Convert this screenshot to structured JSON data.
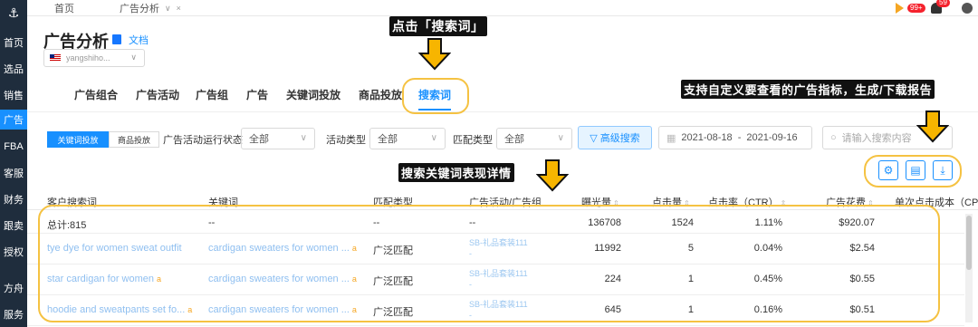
{
  "sidebar": {
    "items": [
      {
        "label": "首页"
      },
      {
        "label": "选品"
      },
      {
        "label": "销售"
      },
      {
        "label": "广告"
      },
      {
        "label": "FBA"
      },
      {
        "label": "客服"
      },
      {
        "label": "财务"
      },
      {
        "label": "跟卖"
      },
      {
        "label": "授权"
      },
      {
        "label": "方舟"
      },
      {
        "label": "服务"
      }
    ],
    "active_index": 3
  },
  "topbar": {
    "tabs": [
      {
        "label": "首页"
      },
      {
        "label": "广告分析"
      }
    ],
    "play_badge": "99+",
    "bell_badge": "59"
  },
  "header": {
    "title": "广告分析",
    "doc_link": "文档",
    "store": "yangshiho..."
  },
  "nav_tabs": [
    {
      "label": "广告组合"
    },
    {
      "label": "广告活动"
    },
    {
      "label": "广告组"
    },
    {
      "label": "广告"
    },
    {
      "label": "关键词投放"
    },
    {
      "label": "商品投放"
    },
    {
      "label": "搜索词"
    }
  ],
  "filters": {
    "seg_keyword": "关键词投放",
    "seg_product": "商品投放",
    "status_label": "广告活动运行状态",
    "status_value": "全部",
    "activity_label": "活动类型",
    "activity_value": "全部",
    "match_label": "匹配类型",
    "match_value": "全部",
    "advanced_search": "高级搜索",
    "date_start": "2021-08-18",
    "date_sep": "-",
    "date_end": "2021-09-16",
    "search_placeholder": "请输入搜索内容"
  },
  "table": {
    "headers": {
      "customer_search_term": "客户搜索词",
      "keyword": "关键词",
      "match_type": "匹配类型",
      "campaign_group": "广告活动/广告组",
      "impressions": "曝光量",
      "clicks": "点击量",
      "ctr": "点击率（CTR）",
      "spend": "广告花费",
      "cpc": "单次点击成本（CP"
    },
    "total": {
      "label": "总计:815",
      "keyword": "--",
      "match_type": "--",
      "campaign": "--",
      "impressions": "136708",
      "clicks": "1524",
      "ctr": "1.11%",
      "spend": "$920.07"
    },
    "rows": [
      {
        "term": "tye dye for women sweat outfit",
        "keyword": "cardigan sweaters for women ...",
        "match_type": "广泛匹配",
        "campaign": "SB-礼品套装111",
        "campaign_sub": "-",
        "impressions": "11992",
        "clicks": "5",
        "ctr": "0.04%",
        "spend": "$2.54"
      },
      {
        "term": "star cardigan for women",
        "keyword": "cardigan sweaters for women ...",
        "match_type": "广泛匹配",
        "campaign": "SB-礼品套装111",
        "campaign_sub": "-",
        "impressions": "224",
        "clicks": "1",
        "ctr": "0.45%",
        "spend": "$0.55"
      },
      {
        "term": "hoodie and sweatpants set fo...",
        "keyword": "cardigan sweaters for women ...",
        "match_type": "广泛匹配",
        "campaign": "SB-礼品套装111",
        "campaign_sub": "-",
        "impressions": "645",
        "clicks": "1",
        "ctr": "0.16%",
        "spend": "$0.51"
      }
    ]
  },
  "annotations": {
    "click_search_term": "点击「搜索词」",
    "custom_metrics": "支持自定义要查看的广告指标，生成/下载报告",
    "search_term_details": "搜索关键词表现详情"
  },
  "colors": {
    "accent": "#1890ff",
    "sidebar": "#1f2d3d",
    "highlight": "#f5c242",
    "arrow": "#f7b500"
  }
}
